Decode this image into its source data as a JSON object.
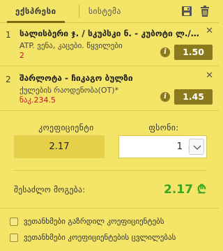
{
  "tabs": {
    "express_label": "ექსპრესი",
    "system_label": "სისტემა"
  },
  "bets": [
    {
      "index": "1",
      "title": "სალისბერი ჯ. / სკუპსკი ნ. - კუბოტი ლ./მ...",
      "market": "ATP. ვენა, კაცები. წყვილები",
      "selection": "2",
      "odds": "1.50"
    },
    {
      "index": "2",
      "title": "შარლოტა - ჩიკაგო ბულზი",
      "market": "ქულების რაოდენობა(OT)*",
      "selection": "ნაკ.234.5",
      "odds": "1.45"
    }
  ],
  "coefficient": {
    "label": "კოეფიციენტი",
    "value": "2.17"
  },
  "amount": {
    "label": "ფსონი:",
    "value": "1",
    "currency": "₾"
  },
  "winnings": {
    "label": "შესაძლო მოგება:",
    "value": "2.17 ₾"
  },
  "options": [
    {
      "label": "ვეთანხმები გაზრდილ კოეფიციენტებს"
    },
    {
      "label": "ვეთანხმები კოეფიციენტების ცვლილებას"
    }
  ],
  "colors": {
    "background": "#f4e467",
    "odds_bg": "#8a7a1c",
    "accent_green": "#3aa520",
    "selection_red": "#c8102e"
  },
  "icons": {
    "save": "save-icon",
    "trash": "trash-icon",
    "close": "close-icon",
    "info": "info-icon",
    "chevron": "chevron-down-icon"
  }
}
